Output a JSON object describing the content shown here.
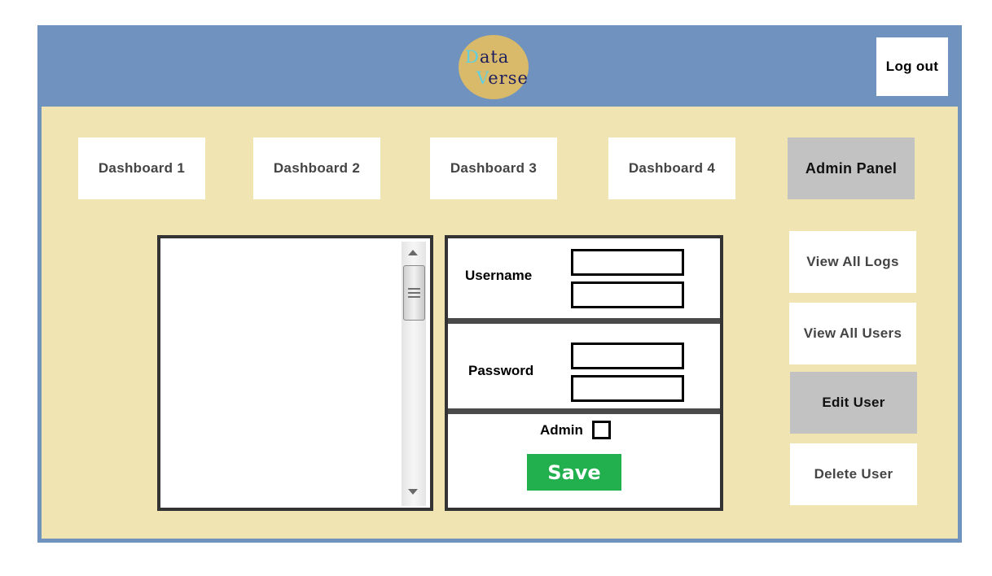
{
  "header": {
    "logo": {
      "line1_initial": "D",
      "line1_rest": "ata",
      "line2_initial": "V",
      "line2_rest": "erse"
    },
    "logout_label": "Log out"
  },
  "nav": {
    "items": [
      {
        "label": "Dashboard 1",
        "active": false
      },
      {
        "label": "Dashboard 2",
        "active": false
      },
      {
        "label": "Dashboard 3",
        "active": false
      },
      {
        "label": "Dashboard 4",
        "active": false
      },
      {
        "label": "Admin Panel",
        "active": true
      }
    ]
  },
  "side_menu": {
    "items": [
      {
        "label": "View All Logs",
        "active": false
      },
      {
        "label": "View All Users",
        "active": false
      },
      {
        "label": "Edit User",
        "active": true
      },
      {
        "label": "Delete User",
        "active": false
      }
    ]
  },
  "user_list": {
    "items": []
  },
  "form": {
    "username_label": "Username",
    "username_value": "",
    "username_confirm_value": "",
    "password_label": "Password",
    "password_value": "",
    "password_confirm_value": "",
    "admin_label": "Admin",
    "admin_checked": false,
    "save_label": "Save"
  },
  "colors": {
    "header_bg": "#6f92be",
    "content_bg": "#efe4b2",
    "logo_bg": "#d9b96a",
    "active_button": "#c2c2c2",
    "save_button": "#22b04f"
  }
}
